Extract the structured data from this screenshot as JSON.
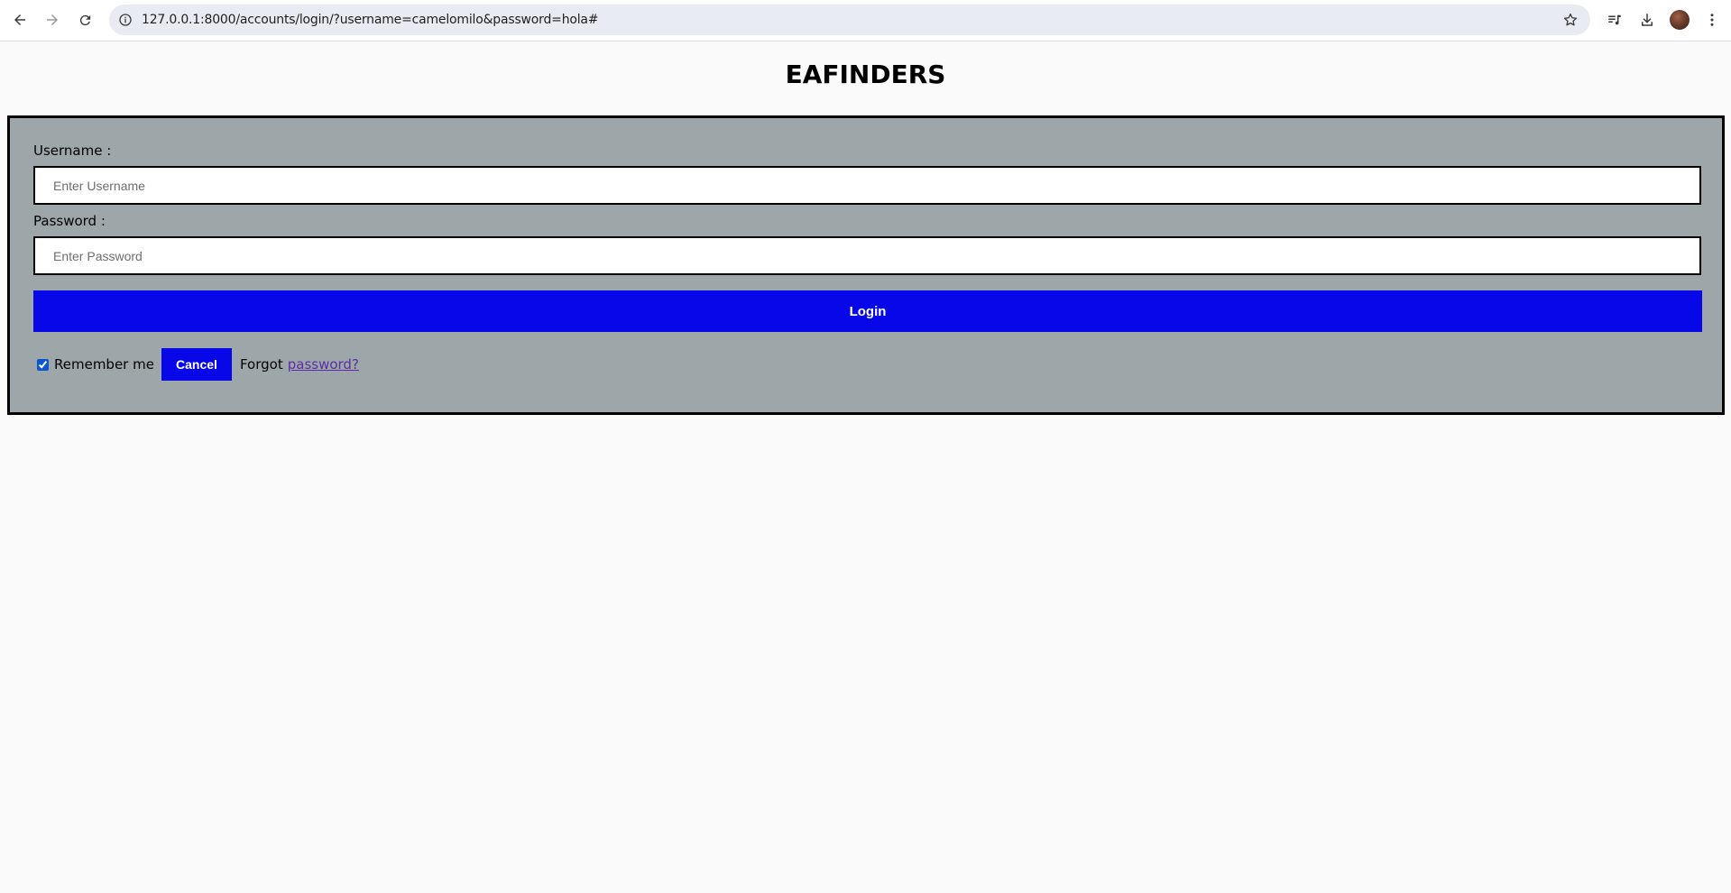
{
  "browser": {
    "url": "127.0.0.1:8000/accounts/login/?username=camelomilo&password=hola#",
    "icons": [
      "back-icon",
      "forward-icon",
      "reload-icon",
      "info-icon",
      "star-icon",
      "media-queue-icon",
      "download-icon",
      "profile-avatar",
      "more-menu-icon"
    ]
  },
  "page": {
    "title": "EAFINDERS"
  },
  "form": {
    "username_label": "Username :",
    "username_placeholder": "Enter Username",
    "password_label": "Password :",
    "password_placeholder": "Enter Password",
    "login_label": "Login",
    "remember_label": "Remember me",
    "remember_checked": true,
    "cancel_label": "Cancel",
    "forgot_text": "Forgot",
    "forgot_link": "password?"
  },
  "colors": {
    "panel_background": "#9da6a9",
    "button_blue": "#0707e8",
    "link_visited": "#5b2ea8",
    "page_background": "#fafafa"
  }
}
